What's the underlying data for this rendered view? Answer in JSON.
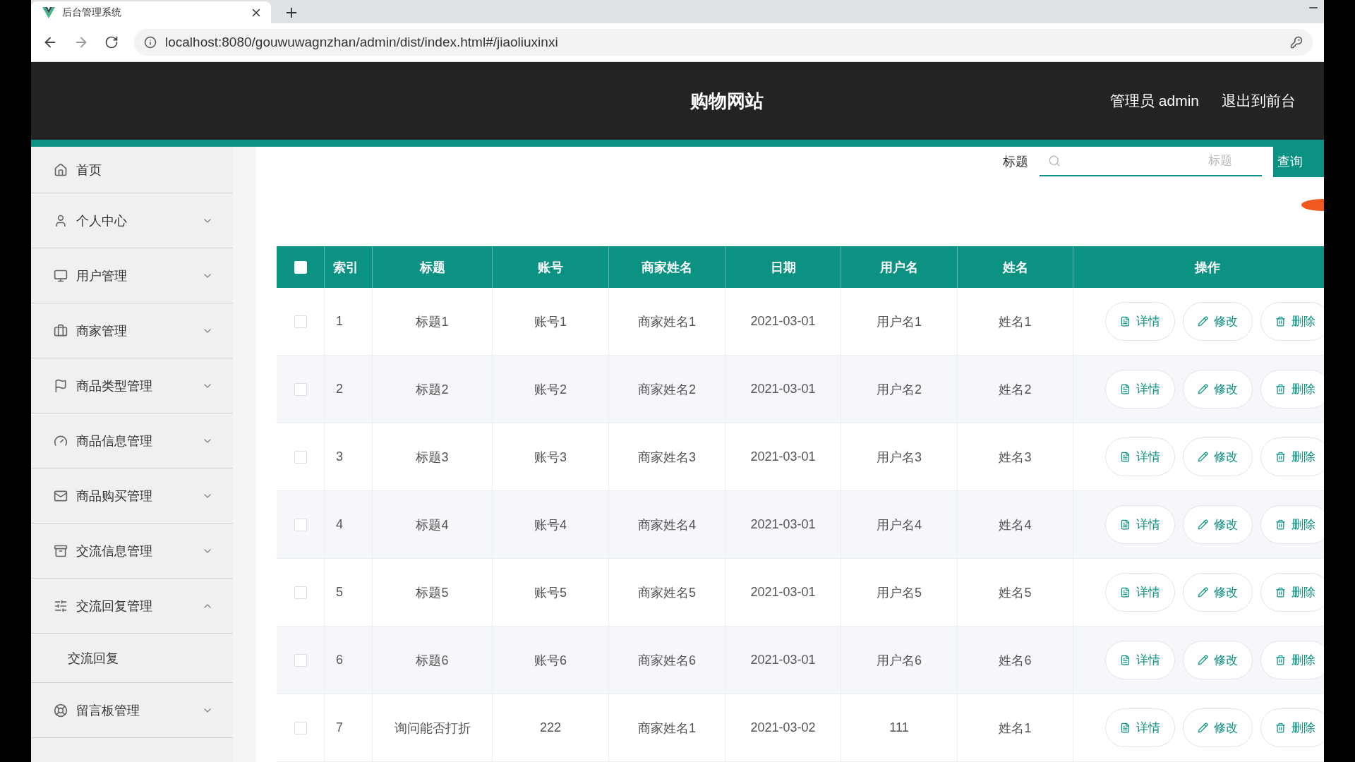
{
  "browser": {
    "tab_title": "后台管理系统",
    "url": "localhost:8080/gouwuwagnzhan/admin/dist/index.html#/jiaoliuxinxi"
  },
  "header": {
    "title": "购物网站",
    "user": "管理员 admin",
    "links": [
      "退出到前台"
    ]
  },
  "sidebar": {
    "items": [
      {
        "label": "首页",
        "kind": "link"
      },
      {
        "label": "个人中心",
        "kind": "menu",
        "expanded": false
      },
      {
        "label": "用户管理",
        "kind": "menu",
        "expanded": false
      },
      {
        "label": "商家管理",
        "kind": "menu",
        "expanded": false
      },
      {
        "label": "商品类型管理",
        "kind": "menu",
        "expanded": false
      },
      {
        "label": "商品信息管理",
        "kind": "menu",
        "expanded": false
      },
      {
        "label": "商品购买管理",
        "kind": "menu",
        "expanded": false
      },
      {
        "label": "交流信息管理",
        "kind": "menu",
        "expanded": false
      },
      {
        "label": "交流回复管理",
        "kind": "menu",
        "expanded": true,
        "children": [
          {
            "label": "交流回复"
          }
        ]
      },
      {
        "label": "留言板管理",
        "kind": "menu",
        "expanded": false
      }
    ]
  },
  "search": {
    "label": "标题",
    "placeholder": "标题",
    "button": "查询"
  },
  "table": {
    "select_all": {
      "checked": false
    },
    "columns": [
      "索引",
      "标题",
      "账号",
      "商家姓名",
      "日期",
      "用户名",
      "姓名",
      "操作"
    ],
    "rows": [
      {
        "checked": false,
        "cells": [
          "1",
          "标题1",
          "账号1",
          "商家姓名1",
          "2021-03-01",
          "用户名1",
          "姓名1"
        ],
        "actions": [
          "详情",
          "修改",
          "删除"
        ]
      },
      {
        "checked": false,
        "cells": [
          "2",
          "标题2",
          "账号2",
          "商家姓名2",
          "2021-03-01",
          "用户名2",
          "姓名2"
        ],
        "actions": [
          "详情",
          "修改",
          "删除"
        ]
      },
      {
        "checked": false,
        "cells": [
          "3",
          "标题3",
          "账号3",
          "商家姓名3",
          "2021-03-01",
          "用户名3",
          "姓名3"
        ],
        "actions": [
          "详情",
          "修改",
          "删除"
        ]
      },
      {
        "checked": false,
        "cells": [
          "4",
          "标题4",
          "账号4",
          "商家姓名4",
          "2021-03-01",
          "用户名4",
          "姓名4"
        ],
        "actions": [
          "详情",
          "修改",
          "删除"
        ]
      },
      {
        "checked": false,
        "cells": [
          "5",
          "标题5",
          "账号5",
          "商家姓名5",
          "2021-03-01",
          "用户名5",
          "姓名5"
        ],
        "actions": [
          "详情",
          "修改",
          "删除"
        ]
      },
      {
        "checked": false,
        "cells": [
          "6",
          "标题6",
          "账号6",
          "商家姓名6",
          "2021-03-01",
          "用户名6",
          "姓名6"
        ],
        "actions": [
          "详情",
          "修改",
          "删除"
        ]
      },
      {
        "checked": false,
        "cells": [
          "7",
          "询问能否打折",
          "222",
          "商家姓名1",
          "2021-03-02",
          "111",
          "姓名1"
        ],
        "actions": [
          "详情",
          "修改",
          "删除"
        ]
      }
    ]
  }
}
